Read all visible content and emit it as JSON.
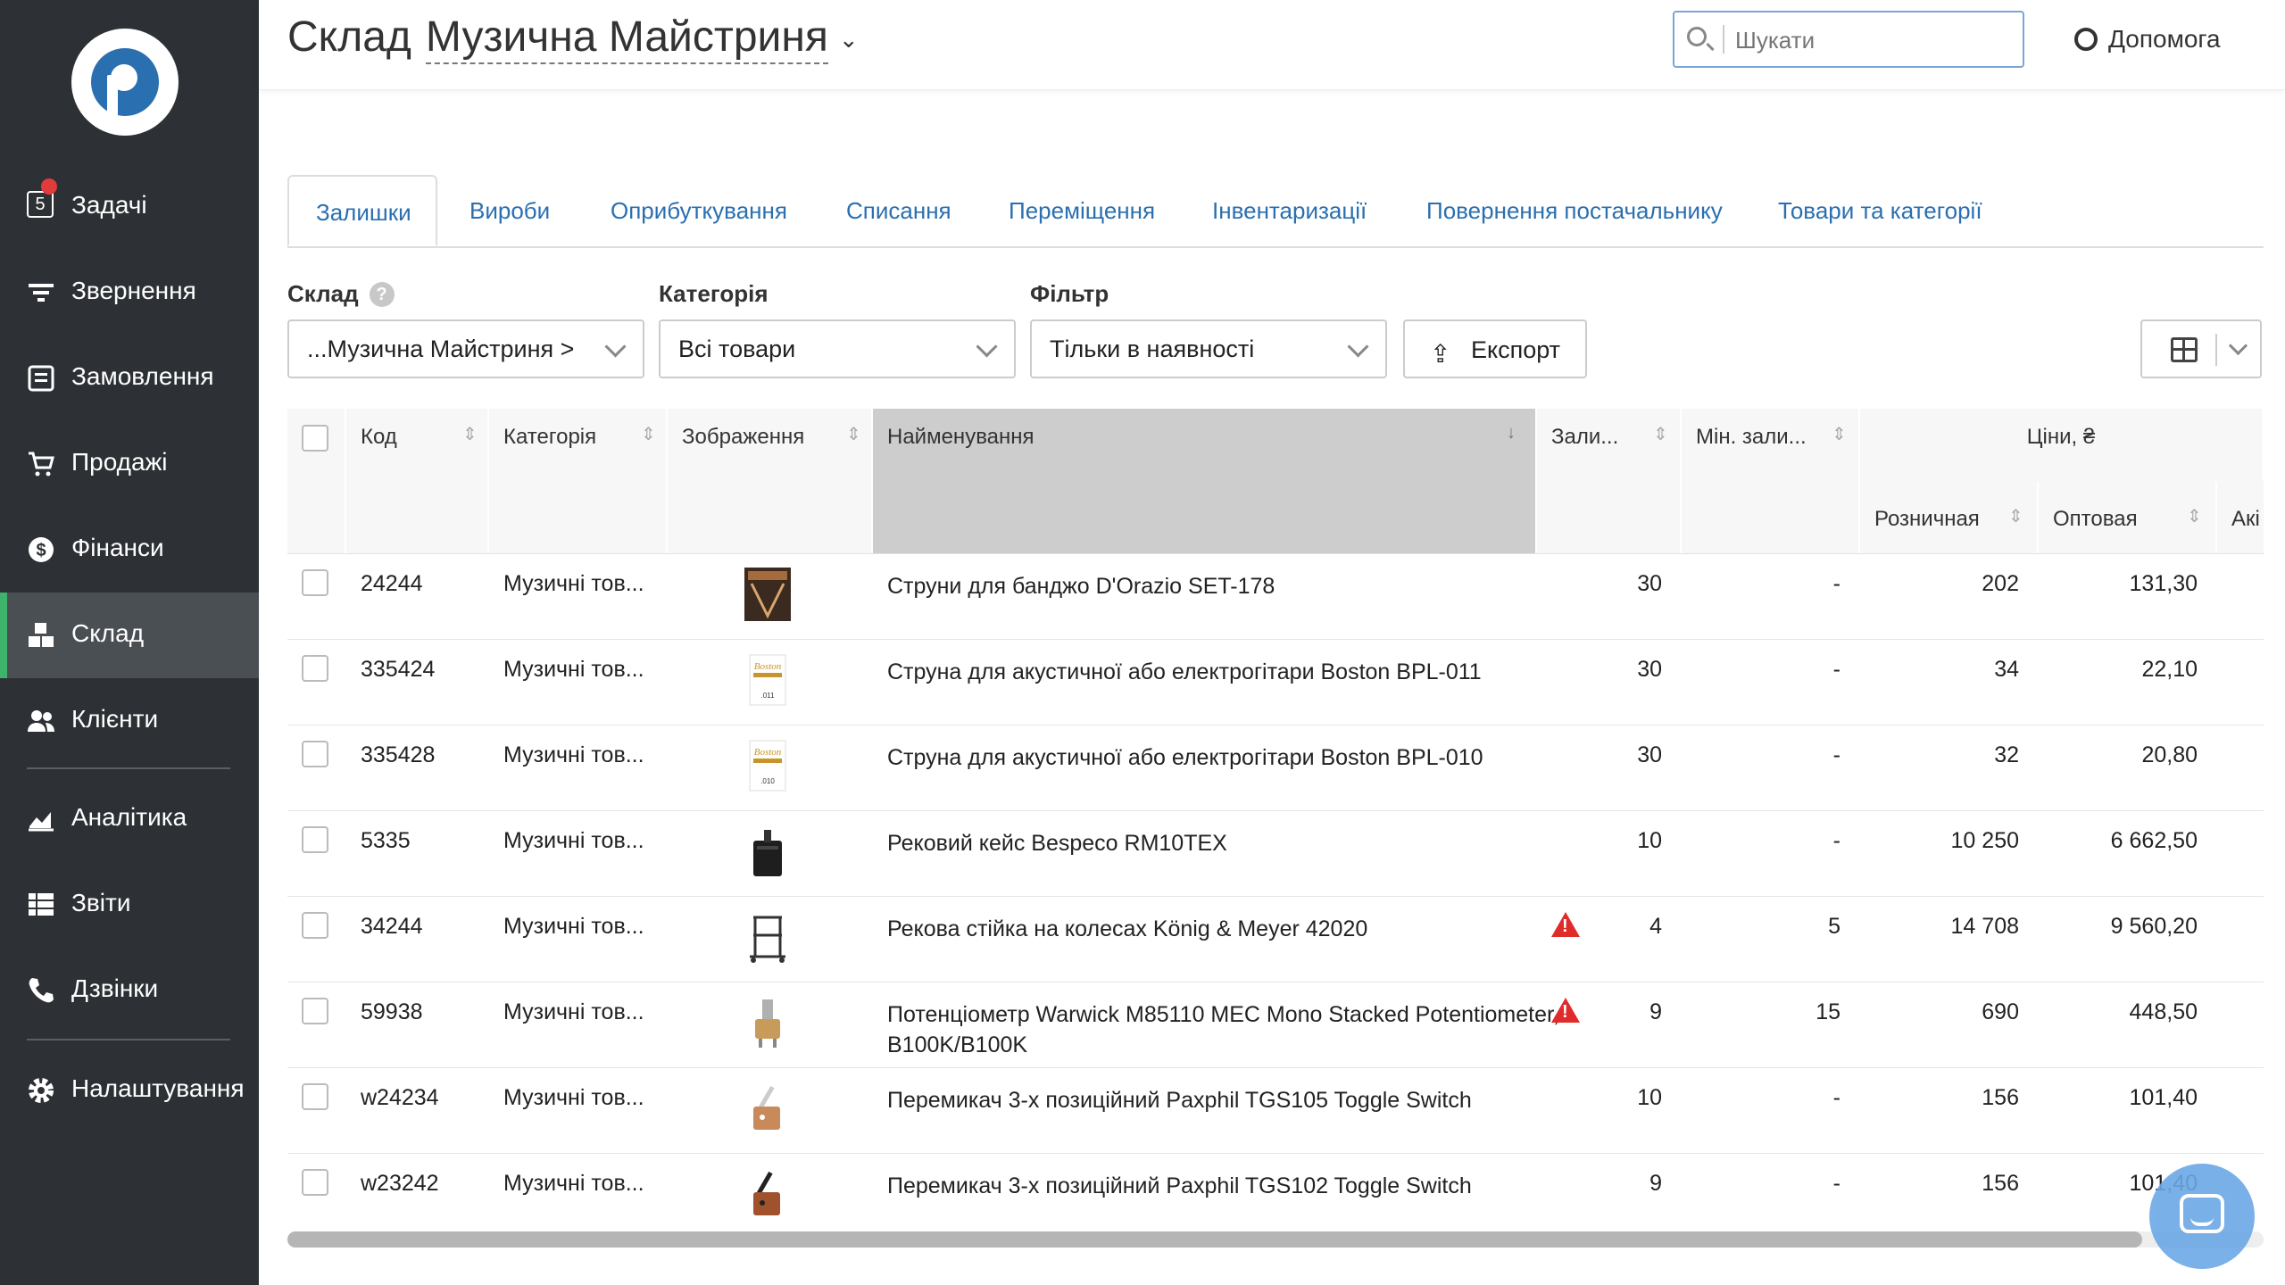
{
  "header": {
    "title": "Склад",
    "store": "Музична Майстриня",
    "search_placeholder": "Шукати",
    "help_label": "Допомога"
  },
  "sidebar": {
    "tasks_badge": "5",
    "items": [
      {
        "label": "Задачі",
        "icon": "tasks-icon"
      },
      {
        "label": "Звернення",
        "icon": "filter-icon"
      },
      {
        "label": "Замовлення",
        "icon": "orders-icon"
      },
      {
        "label": "Продажі",
        "icon": "cart-icon"
      },
      {
        "label": "Фінанси",
        "icon": "dollar-icon"
      },
      {
        "label": "Склад",
        "icon": "boxes-icon",
        "active": true
      },
      {
        "label": "Клієнти",
        "icon": "users-icon"
      },
      {
        "label": "Аналітика",
        "icon": "chart-icon"
      },
      {
        "label": "Звіти",
        "icon": "list-icon"
      },
      {
        "label": "Дзвінки",
        "icon": "phone-icon"
      },
      {
        "label": "Налаштування",
        "icon": "gear-icon"
      }
    ]
  },
  "tabs": [
    "Залишки",
    "Вироби",
    "Оприбуткування",
    "Списання",
    "Переміщення",
    "Інвентаризації",
    "Повернення постачальнику",
    "Товари та категорії"
  ],
  "filters": {
    "warehouse_label": "Склад",
    "warehouse_value": "...Музична Майстриня >",
    "category_label": "Категорія",
    "category_value": "Всі товари",
    "filter_label": "Фільтр",
    "filter_value": "Тільки в наявності",
    "export_label": "Експорт"
  },
  "table": {
    "columns": {
      "code": "Код",
      "category": "Категорія",
      "image": "Зображення",
      "name": "Найменування",
      "stock": "Зали...",
      "min_stock": "Мін. зали...",
      "prices": "Ціни, ₴",
      "retail": "Розничная",
      "wholesale": "Оптовая",
      "promo": "Акі"
    },
    "rows": [
      {
        "code": "24244",
        "category": "Музичні тов...",
        "name": "Струни для банджо D'Orazio SET-178",
        "stock": "30",
        "min": "-",
        "retail": "202",
        "wholesale": "131,30",
        "warn": false
      },
      {
        "code": "335424",
        "category": "Музичні тов...",
        "name": "Струна для акустичної або електрогітари Boston BPL-011",
        "stock": "30",
        "min": "-",
        "retail": "34",
        "wholesale": "22,10",
        "warn": false
      },
      {
        "code": "335428",
        "category": "Музичні тов...",
        "name": "Струна для акустичної або електрогітари Boston BPL-010",
        "stock": "30",
        "min": "-",
        "retail": "32",
        "wholesale": "20,80",
        "warn": false
      },
      {
        "code": "5335",
        "category": "Музичні тов...",
        "name": "Рековий кейс Bespeco RM10TEX",
        "stock": "10",
        "min": "-",
        "retail": "10 250",
        "wholesale": "6 662,50",
        "warn": false
      },
      {
        "code": "34244",
        "category": "Музичні тов...",
        "name": "Рекова стійка на колесах König & Meyer 42020",
        "stock": "4",
        "min": "5",
        "retail": "14 708",
        "wholesale": "9 560,20",
        "warn": true
      },
      {
        "code": "59938",
        "category": "Музичні тов...",
        "name": "Потенціометр Warwick M85110 MEC Mono Stacked Potentiometer, B100K/B100K",
        "stock": "9",
        "min": "15",
        "retail": "690",
        "wholesale": "448,50",
        "warn": true
      },
      {
        "code": "w24234",
        "category": "Музичні тов...",
        "name": "Перемикач 3-х позиційний Paxphil TGS105 Toggle Switch",
        "stock": "10",
        "min": "-",
        "retail": "156",
        "wholesale": "101,40",
        "warn": false
      },
      {
        "code": "w23242",
        "category": "Музичні тов...",
        "name": "Перемикач 3-х позиційний Paxphil TGS102 Toggle Switch",
        "stock": "9",
        "min": "-",
        "retail": "156",
        "wholesale": "101,40",
        "warn": false
      }
    ]
  },
  "colors": {
    "sidebar": "#2d3135",
    "accent": "#2a6fb0",
    "active_bar": "#3eb36b",
    "warning": "#e02b2b"
  }
}
